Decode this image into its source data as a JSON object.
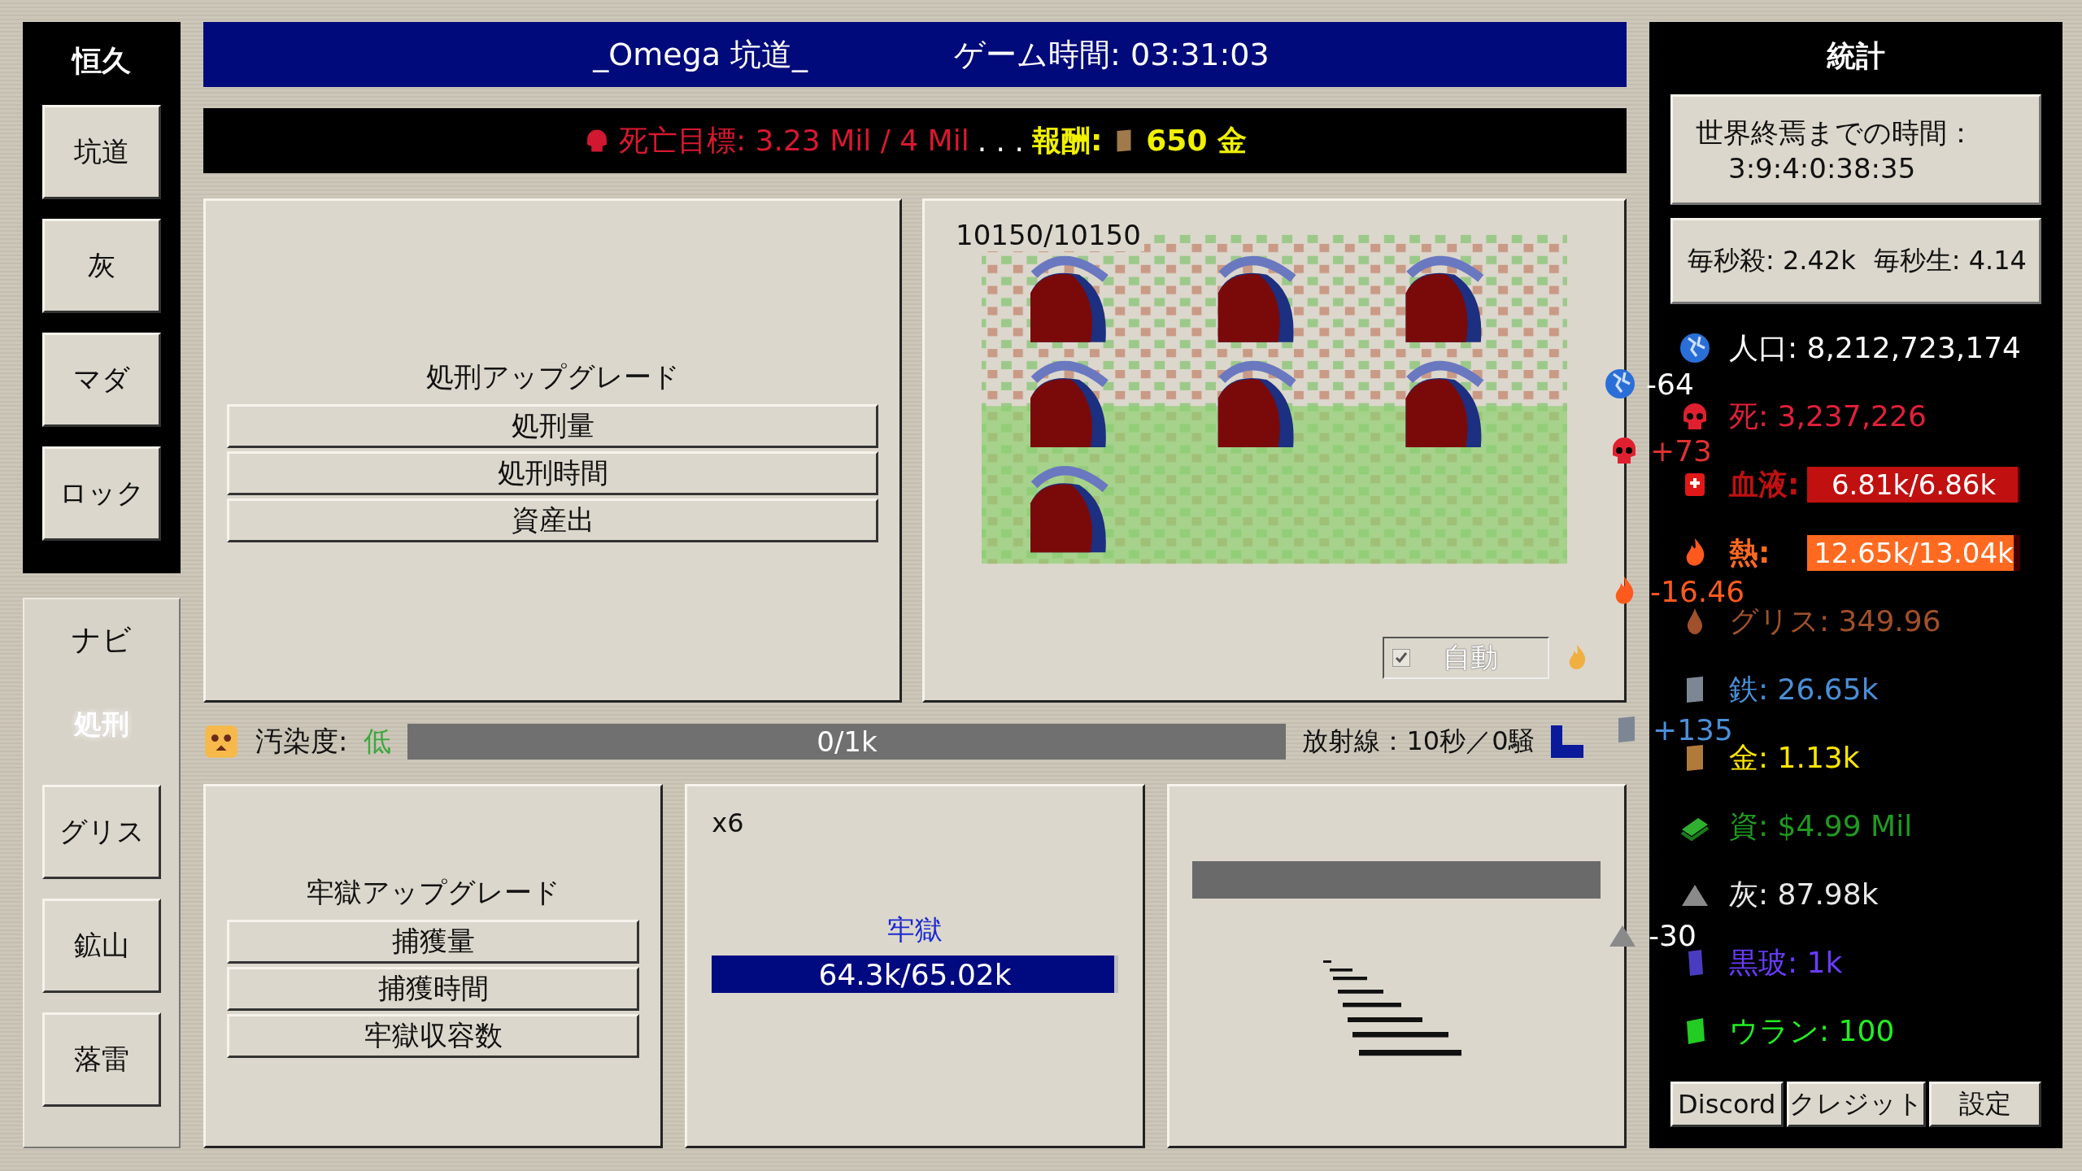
{
  "sidebar_top": {
    "title": "恒久",
    "items": [
      {
        "label": "坑道",
        "selected": false
      },
      {
        "label": "灰",
        "selected": false
      },
      {
        "label": "マダ",
        "selected": false
      },
      {
        "label": "ロック",
        "selected": false
      }
    ]
  },
  "sidebar_bottom": {
    "title": "ナビ",
    "items": [
      {
        "label": "処刑",
        "selected": true
      },
      {
        "label": "グリス",
        "selected": false
      },
      {
        "label": "鉱山",
        "selected": false
      },
      {
        "label": "落雷",
        "selected": false
      }
    ]
  },
  "header": {
    "title": "_Omega 坑道_",
    "game_time": "ゲーム時間: 03:31:03"
  },
  "goal_bar": {
    "goal": "死亡目標: 3.23 Mil / 4 Mil",
    "separator": ". . .",
    "reward_label": "報酬:",
    "reward": "650 金"
  },
  "execution_panel": {
    "title": "処刑アップグレード",
    "buttons": [
      {
        "label": "処刑量"
      },
      {
        "label": "処刑時間"
      },
      {
        "label": "資産出"
      }
    ]
  },
  "field_panel": {
    "count": "10150/10150",
    "auto": {
      "label": "自動",
      "checked": true
    }
  },
  "pollution": {
    "label": "汚染度:",
    "value": "低",
    "bar": {
      "text": "0/1k"
    },
    "radiation": "放射線：10秒／0騒"
  },
  "prison_panel": {
    "title": "牢獄アップグレード",
    "buttons": [
      {
        "label": "捕獲量"
      },
      {
        "label": "捕獲時間"
      },
      {
        "label": "牢獄収容数"
      }
    ]
  },
  "prison_status": {
    "multiplier": "x6",
    "label": "牢獄",
    "bar": {
      "text": "64.3k/65.02k",
      "level": 0.99
    }
  },
  "stats": {
    "title": "統計",
    "doomsday_label": "世界終焉までの時間：",
    "doomsday": "3:9:4:0:38:35",
    "rates": [
      "毎秒殺: 2.42k",
      "毎秒生: 4.14"
    ],
    "rows": [
      {
        "kind": "text",
        "text": "人口: 8,212,723,174",
        "color": "#ffffff"
      },
      {
        "kind": "text",
        "text": "死: 3,237,226",
        "color": "#e0203a"
      },
      {
        "kind": "bar",
        "label": "血液:",
        "value": "6.81k/6.86k",
        "level": 0.99,
        "color": "#c01010"
      },
      {
        "kind": "bar",
        "label": "熱:",
        "value": "12.65k/13.04k",
        "level": 0.97,
        "color": "#ff6a20"
      },
      {
        "kind": "text",
        "text": "グリス: 349.96",
        "color": "#a0502a"
      },
      {
        "kind": "text",
        "text": "鉄: 26.65k",
        "color": "#4a8fd8"
      },
      {
        "kind": "text",
        "text": "金: 1.13k",
        "color": "#ffe600"
      },
      {
        "kind": "text",
        "text": "資: $4.99 Mil",
        "color": "#1f9a1f"
      },
      {
        "kind": "text",
        "text": "灰: 87.98k",
        "color": "#e8e8e8"
      },
      {
        "kind": "text",
        "text": "黒玻: 1k",
        "color": "#6a3cff"
      },
      {
        "kind": "text",
        "text": "ウラン: 100",
        "color": "#22ee22"
      }
    ],
    "buttons": [
      "Discord",
      "クレジット",
      "設定"
    ]
  },
  "deltas": [
    {
      "text": "-64",
      "color": "#ffffff"
    },
    {
      "text": "+73",
      "color": "#e03030"
    },
    {
      "text": "-16.46",
      "color": "#ff5a1e"
    },
    {
      "text": "+135",
      "color": "#4a8fd8"
    },
    {
      "text": "-30",
      "color": "#ffffff"
    }
  ]
}
